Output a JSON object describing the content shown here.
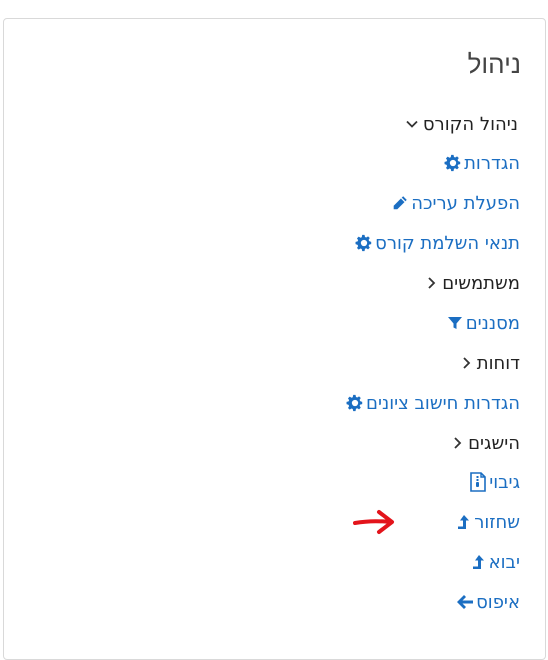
{
  "block": {
    "title": "ניהול",
    "items": [
      {
        "label": "ניהול הקורס",
        "icon": "chevron-down-icon",
        "style": "dark"
      },
      {
        "label": "הגדרות",
        "icon": "gear-icon",
        "style": "link"
      },
      {
        "label": "הפעלת עריכה",
        "icon": "pencil-icon",
        "style": "link"
      },
      {
        "label": "תנאי השלמת קורס",
        "icon": "gear-icon",
        "style": "link"
      },
      {
        "label": "משתמשים",
        "icon": "chevron-right-icon",
        "style": "dark"
      },
      {
        "label": "מסננים",
        "icon": "filter-icon",
        "style": "link"
      },
      {
        "label": "דוחות",
        "icon": "chevron-right-icon",
        "style": "dark"
      },
      {
        "label": "הגדרות חישוב ציונים",
        "icon": "gear-icon",
        "style": "link"
      },
      {
        "label": "הישגים",
        "icon": "chevron-right-icon",
        "style": "dark"
      },
      {
        "label": "גיבוי",
        "icon": "archive-file-icon",
        "style": "link"
      },
      {
        "label": "שחזור",
        "icon": "upload-arrow-icon",
        "style": "link"
      },
      {
        "label": "יבוא",
        "icon": "upload-arrow-icon",
        "style": "link"
      },
      {
        "label": "איפוס",
        "icon": "arrow-left-icon",
        "style": "link"
      }
    ]
  },
  "colors": {
    "link": "#1b6ec2",
    "dark": "#222222",
    "annotation_arrow": "#e3141b"
  }
}
